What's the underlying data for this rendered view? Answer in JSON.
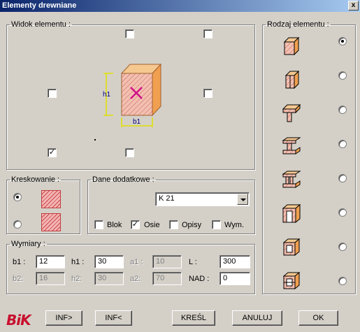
{
  "window": {
    "title": "Elementy drewniane",
    "close_symbol": "x"
  },
  "widok": {
    "legend": "Widok elementu :",
    "checkboxes": [
      {
        "name": "top-center",
        "checked": false
      },
      {
        "name": "top-right",
        "checked": false
      },
      {
        "name": "middle-left",
        "checked": false
      },
      {
        "name": "middle-right",
        "checked": false
      },
      {
        "name": "bottom-left",
        "checked": true
      },
      {
        "name": "bottom-center",
        "checked": false
      }
    ],
    "dim_h": "h1",
    "dim_b": "b1"
  },
  "kreskowanie": {
    "legend": "Kreskowanie :",
    "selected": 0
  },
  "dane": {
    "legend": "Dane dodatkowe :",
    "select_value": "K 21",
    "checks": [
      {
        "label": "Blok",
        "checked": false
      },
      {
        "label": "Osie",
        "checked": true
      },
      {
        "label": "Opisy",
        "checked": false
      },
      {
        "label": "Wym.",
        "checked": false
      }
    ]
  },
  "wymiary": {
    "legend": "Wymiary :",
    "row1": [
      {
        "label": "b1 :",
        "value": "12",
        "enabled": true
      },
      {
        "label": "h1 :",
        "value": "30",
        "enabled": true
      },
      {
        "label": "a1 :",
        "value": "10",
        "enabled": false
      },
      {
        "label": "L :",
        "value": "300",
        "enabled": true
      }
    ],
    "row2": [
      {
        "label": "b2:",
        "value": "16",
        "enabled": false
      },
      {
        "label": "h2:",
        "value": "30",
        "enabled": false
      },
      {
        "label": "a2:",
        "value": "70",
        "enabled": false
      },
      {
        "label": "NAD :",
        "value": "0",
        "enabled": true
      }
    ]
  },
  "rodzaj": {
    "legend": "Rodzaj elementu :",
    "selected": 0,
    "items": [
      "rectangular-beam",
      "notched-beam",
      "t-section",
      "i-section",
      "double-i-section",
      "box-section",
      "frame-section",
      "hollow-section"
    ]
  },
  "buttons": {
    "inf_next": "INF>",
    "inf_prev": "INF<",
    "draw": "KREŚL",
    "cancel": "ANULUJ",
    "ok": "OK"
  },
  "logo": "BiK",
  "check_symbol": "✓",
  "colors": {
    "title_start": "#0a246a",
    "title_end": "#a6caf0",
    "accent": "#c8102e",
    "wood_front": "#e8a890",
    "wood_side": "#f0a060"
  }
}
